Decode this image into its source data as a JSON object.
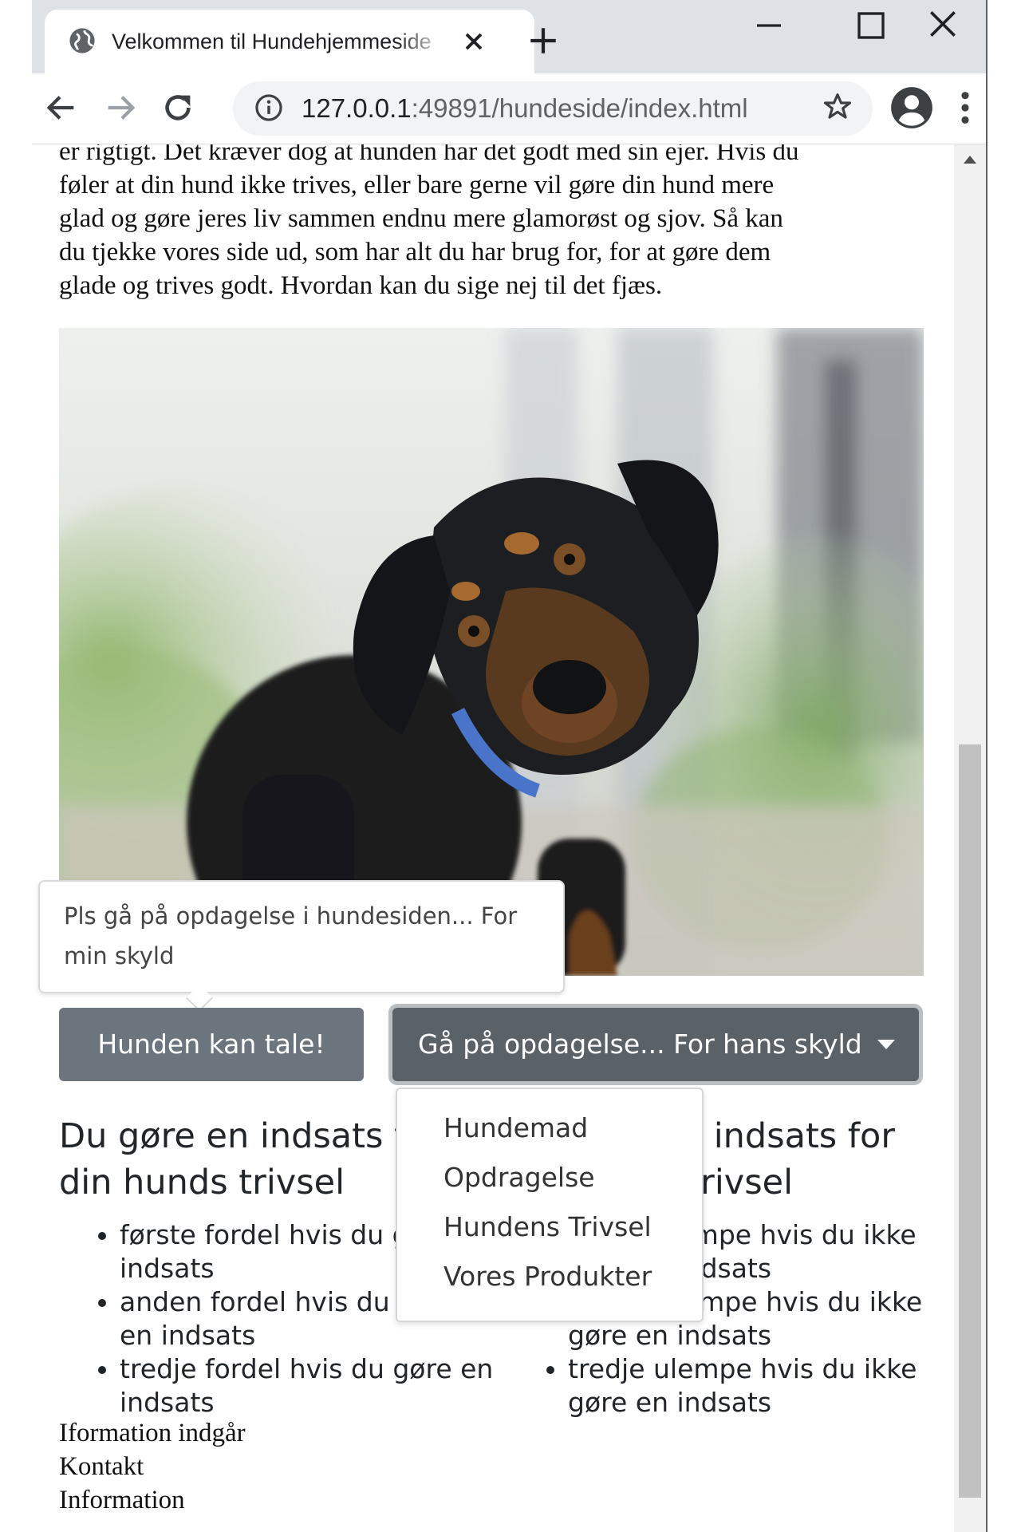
{
  "browser": {
    "tab_title": "Velkommen til Hundehjemmeside",
    "url_host": "127.0.0.1",
    "url_rest": ":49891/hundeside/index.html",
    "icons": [
      "globe-icon",
      "close-icon",
      "plus-icon",
      "minimize-icon",
      "maximize-icon",
      "close-window-icon",
      "back-icon",
      "forward-icon",
      "reload-icon",
      "info-icon",
      "star-icon",
      "profile-icon",
      "menu-icon"
    ]
  },
  "page": {
    "intro_lines": [
      "er rigtigt. Det kræver dog at hunden har det godt med sin ejer. Hvis du",
      "føler at din hund ikke trives, eller bare gerne vil gøre din hund mere",
      "glad og gøre jeres liv sammen endnu mere glamorøst og sjov. Så kan",
      "du tjekke vores side ud, som har alt du har brug for, for at gøre dem",
      "glade og trives godt. Hvordan kan du sige nej til det fjæs."
    ],
    "tooltip_text": "Pls gå på opdagelse i hundesiden... For min skyld",
    "talk_button": "Hunden kan tale!",
    "explore_button": "Gå på opdagelse... For hans skyld",
    "dropdown_items": [
      "Hundemad",
      "Opdragelse",
      "Hundens Trivsel",
      "Vores Produkter"
    ],
    "left_heading": "Du gøre en indsats for din hunds trivsel",
    "left_list": [
      "første fordel hvis du gøre en indsats",
      "anden fordel hvis du gøre en indsats",
      "tredje fordel hvis du gøre en indsats"
    ],
    "right_heading": "Gør ikke en indsats for din hunds trivsel",
    "right_list": [
      "første ulempe hvis du ikke gøre en indsats",
      "anden ulempe hvis du ikke gøre en indsats",
      "tredje ulempe hvis du ikke gøre en indsats"
    ],
    "footer_links": [
      "Iformation indgår",
      "Kontakt",
      "Information"
    ]
  },
  "colors": {
    "button_secondary": "#6c757d",
    "button_active": "#5a6268",
    "tabstrip": "#dee1e6"
  }
}
